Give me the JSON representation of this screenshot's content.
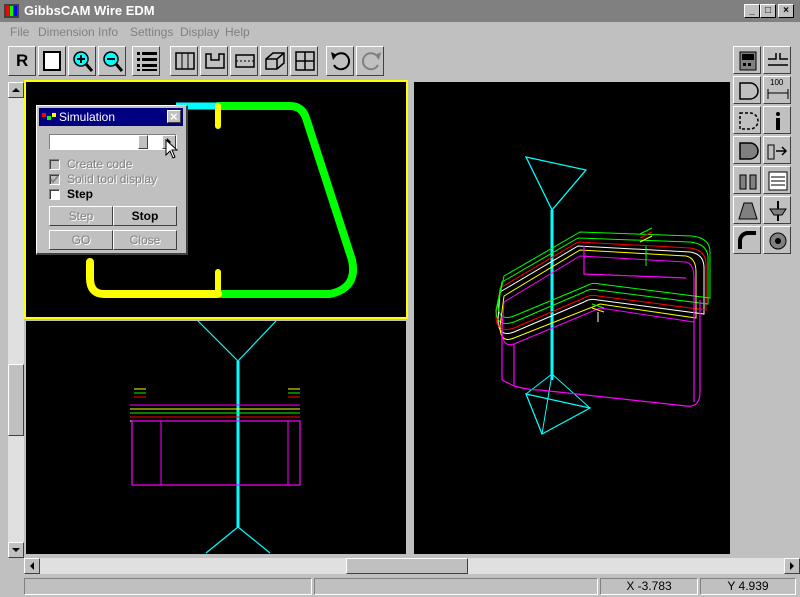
{
  "window": {
    "title": "GibbsCAM Wire EDM",
    "min_label": "_",
    "max_label": "□",
    "close_label": "×"
  },
  "menu": {
    "items": [
      "File",
      "Dimension",
      "Info",
      "Settings",
      "Display",
      "Help"
    ]
  },
  "toolbar": {
    "r_label": "R"
  },
  "simulation": {
    "title": "Simulation",
    "close_label": "×",
    "options": [
      {
        "label": "Create code",
        "checked": false,
        "enabled": false
      },
      {
        "label": "Solid tool display",
        "checked": true,
        "enabled": false
      },
      {
        "label": "Step",
        "checked": false,
        "enabled": true
      }
    ],
    "buttons": [
      {
        "label": "Step",
        "enabled": false
      },
      {
        "label": "Stop",
        "enabled": true
      },
      {
        "label": "GO",
        "enabled": false
      },
      {
        "label": "Close",
        "enabled": false
      }
    ],
    "slider_value": 0.78
  },
  "rightpanel": {
    "dimension_label": "100"
  },
  "status": {
    "x_readout": "X -3.783",
    "y_readout": "Y 4.939"
  },
  "colors": {
    "titlebar_inactive": "#808080",
    "dialog_title": "#000080",
    "viewport_bg": "#000000",
    "active_view_border": "#ffff00",
    "path_green": "#00ff00",
    "path_yellow": "#ffff00",
    "path_cyan": "#00ffff",
    "part_magenta": "#ff00ff"
  }
}
